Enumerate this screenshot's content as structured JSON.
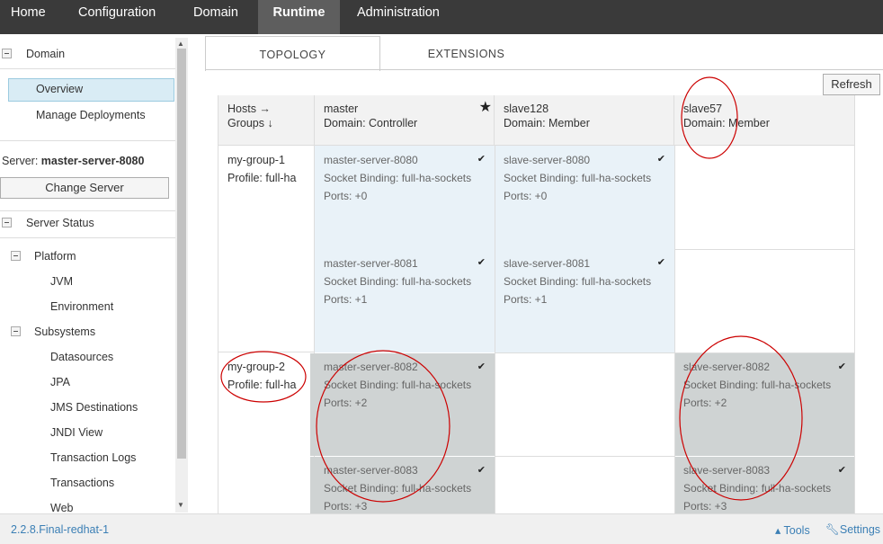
{
  "topnav": {
    "items": [
      "Home",
      "Configuration",
      "Domain",
      "Runtime",
      "Administration"
    ],
    "active": "Runtime"
  },
  "sidebar": {
    "domain_label": "Domain",
    "overview": "Overview",
    "manage_deployments": "Manage Deployments",
    "server_prefix": "Server:",
    "server_name": "master-server-8080",
    "change_server": "Change Server",
    "server_status": "Server Status",
    "platform": "Platform",
    "jvm": "JVM",
    "environment": "Environment",
    "subsystems": "Subsystems",
    "datasources": "Datasources",
    "jpa": "JPA",
    "jms": "JMS Destinations",
    "jndi": "JNDI View",
    "txlogs": "Transaction Logs",
    "transactions": "Transactions",
    "web": "Web"
  },
  "tabs": {
    "topology": "TOPOLOGY",
    "extensions": "EXTENSIONS"
  },
  "refresh": "Refresh",
  "grid": {
    "corner": {
      "line1": "Hosts →",
      "line2": "Groups ↓"
    },
    "hosts": [
      {
        "name": "master",
        "role": "Domain: Controller"
      },
      {
        "name": "slave128",
        "role": "Domain: Member"
      },
      {
        "name": "slave57",
        "role": "Domain: Member"
      }
    ],
    "groups": [
      {
        "name": "my-group-1",
        "profile": "Profile: full-ha"
      },
      {
        "name": "my-group-2",
        "profile": "Profile: full-ha"
      }
    ],
    "servers": {
      "m8080": {
        "name": "master-server-8080",
        "binding": "Socket Binding: full-ha-sockets",
        "ports": "Ports: +0"
      },
      "s8080": {
        "name": "slave-server-8080",
        "binding": "Socket Binding: full-ha-sockets",
        "ports": "Ports: +0"
      },
      "m8081": {
        "name": "master-server-8081",
        "binding": "Socket Binding: full-ha-sockets",
        "ports": "Ports: +1"
      },
      "s8081": {
        "name": "slave-server-8081",
        "binding": "Socket Binding: full-ha-sockets",
        "ports": "Ports: +1"
      },
      "m8082": {
        "name": "master-server-8082",
        "binding": "Socket Binding: full-ha-sockets",
        "ports": "Ports: +2"
      },
      "s8082": {
        "name": "slave-server-8082",
        "binding": "Socket Binding: full-ha-sockets",
        "ports": "Ports: +2"
      },
      "m8083": {
        "name": "master-server-8083",
        "binding": "Socket Binding: full-ha-sockets",
        "ports": "Ports: +3"
      },
      "s8083": {
        "name": "slave-server-8083",
        "binding": "Socket Binding: full-ha-sockets",
        "ports": "Ports: +3"
      }
    }
  },
  "footer": {
    "version": "2.2.8.Final-redhat-1",
    "tools": "▴ Tools",
    "settings": "Settings"
  },
  "colors": {
    "accent": "#3b7fb5",
    "annotation": "#cc0000",
    "nav": "#3a3a3a"
  }
}
